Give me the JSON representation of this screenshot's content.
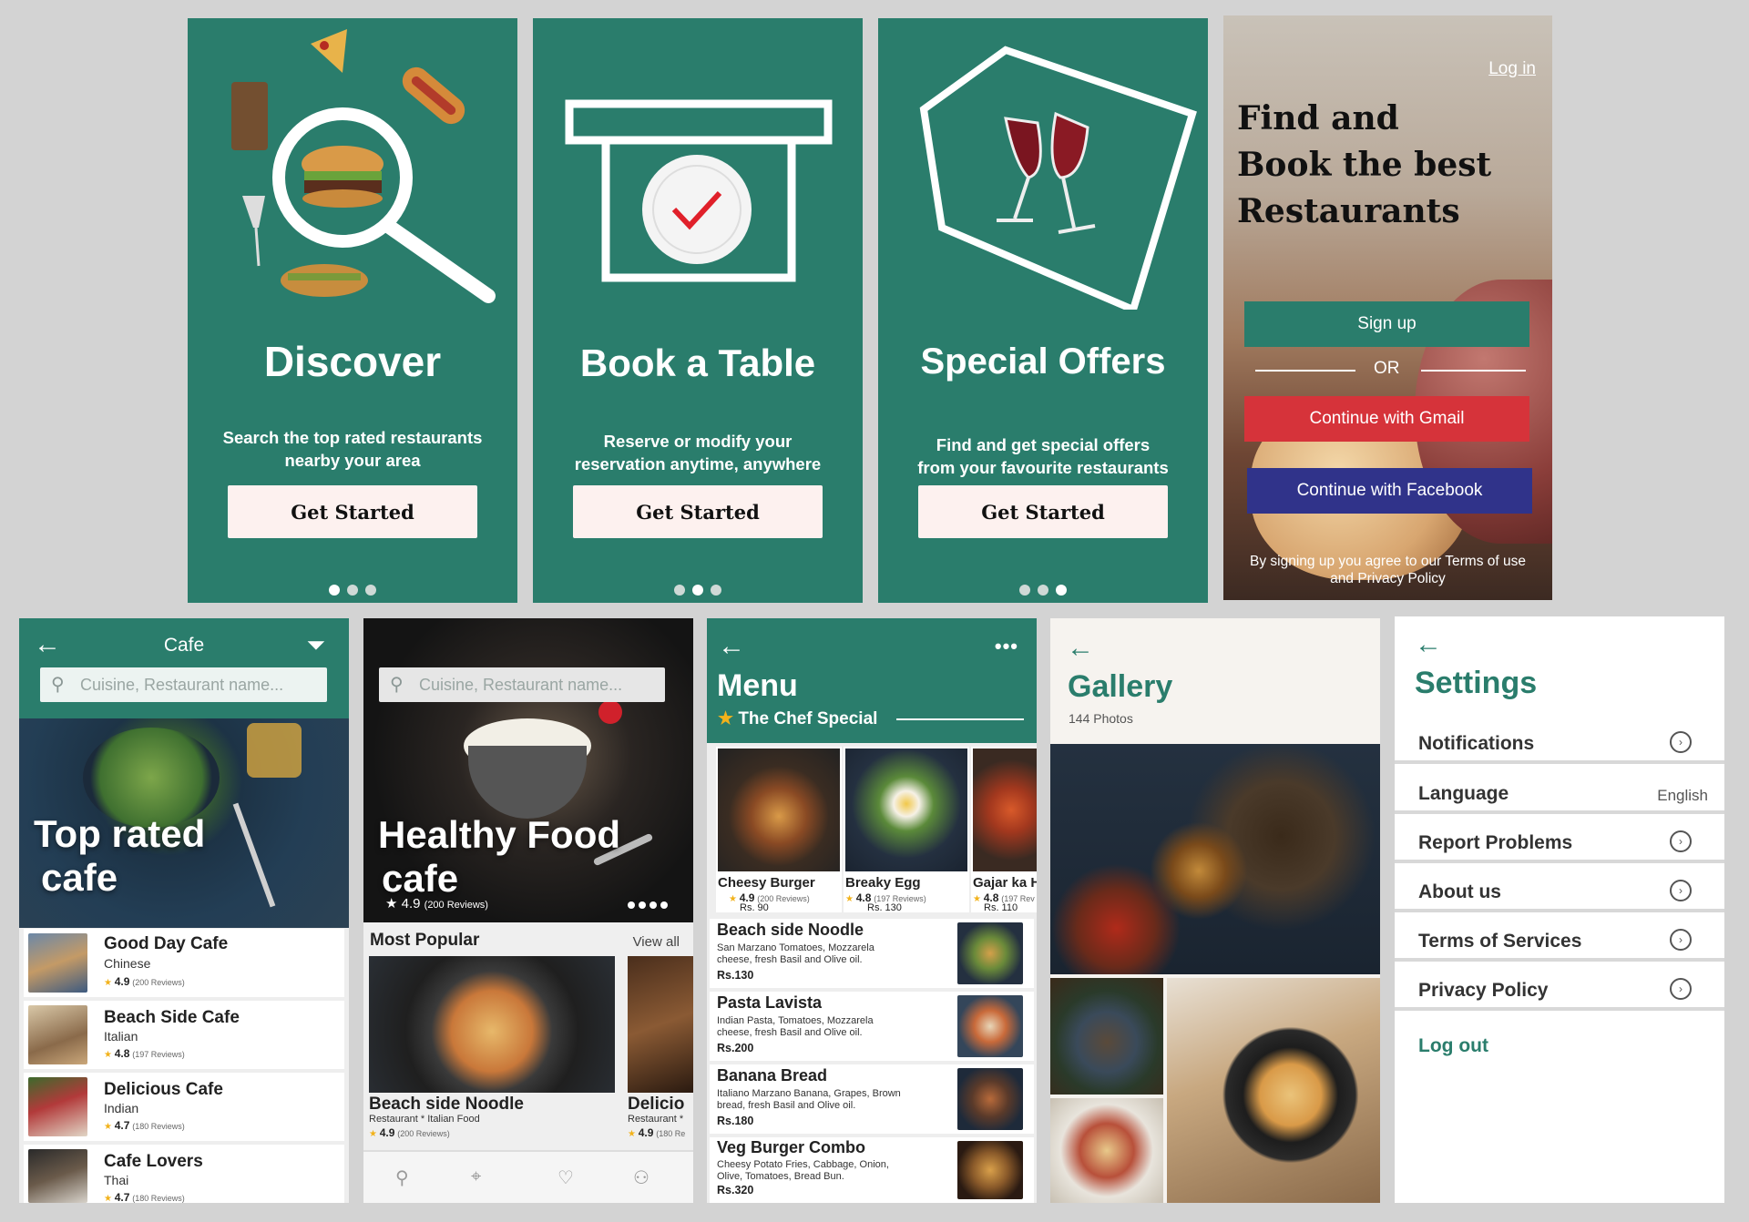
{
  "onboarding": [
    {
      "title": "Discover",
      "desc_line1": "Search the top rated restaurants",
      "desc_line2": "nearby your area",
      "button": "Get Started",
      "active_dot": 0
    },
    {
      "title": "Book a Table",
      "desc_line1": "Reserve or modify your",
      "desc_line2": "reservation anytime, anywhere",
      "button": "Get Started",
      "active_dot": 1
    },
    {
      "title": "Special Offers",
      "desc_line1": "Find and get special offers",
      "desc_line2": "from your favourite restaurants",
      "button": "Get Started",
      "active_dot": 2
    }
  ],
  "login": {
    "login_link": "Log in",
    "headline_1": "Find and",
    "headline_2": "Book the best",
    "headline_3": "Restaurants",
    "signup": "Sign up",
    "or": "OR",
    "gmail": "Continue with Gmail",
    "facebook": "Continue with Facebook",
    "terms_1": "By signing up you agree to our Terms of use",
    "terms_2": "and Privacy Policy",
    "colors": {
      "signup": "#2a7d6c",
      "gmail": "#d6333a",
      "facebook": "#30338a"
    }
  },
  "cafe": {
    "title": "Cafe",
    "search_placeholder": "Cuisine, Restaurant name...",
    "hero_line1": "Top rated",
    "hero_line2": "cafe",
    "items": [
      {
        "name": "Good Day Cafe",
        "cuisine": "Chinese",
        "rating": "4.9",
        "reviews": "(200 Reviews)"
      },
      {
        "name": "Beach Side Cafe",
        "cuisine": "Italian",
        "rating": "4.8",
        "reviews": "(197 Reviews)"
      },
      {
        "name": "Delicious Cafe",
        "cuisine": "Indian",
        "rating": "4.7",
        "reviews": "(180 Reviews)"
      },
      {
        "name": "Cafe Lovers",
        "cuisine": "Thai",
        "rating": "4.7",
        "reviews": "(180 Reviews)"
      }
    ]
  },
  "healthy": {
    "search_placeholder": "Cuisine, Restaurant name...",
    "hero_line1": "Healthy Food",
    "hero_line2": "cafe",
    "hero_rating": "4.9",
    "hero_reviews": "(200 Reviews)",
    "section_title": "Most Popular",
    "view_all": "View all",
    "cards": [
      {
        "name": "Beach side Noodle",
        "meta": "Restaurant * Italian Food",
        "rating": "4.9",
        "reviews": "(200 Reviews)"
      },
      {
        "name": "Delicio",
        "meta": "Restaurant *",
        "rating": "4.9",
        "reviews": "(180 Re"
      }
    ]
  },
  "menu": {
    "title": "Menu",
    "chef_special": "The Chef Special",
    "specials": [
      {
        "name": "Cheesy Burger",
        "rating": "4.9",
        "reviews": "(200 Reviews)",
        "price": "Rs. 90"
      },
      {
        "name": "Breaky Egg",
        "rating": "4.8",
        "reviews": "(197 Reviews)",
        "price": "Rs. 130"
      },
      {
        "name": "Gajar ka H",
        "rating": "4.8",
        "reviews": "(197 Rev",
        "price": "Rs. 110"
      }
    ],
    "items": [
      {
        "name": "Beach side Noodle",
        "desc_1": "San Marzano Tomatoes, Mozzarela",
        "desc_2": "cheese, fresh Basil and Olive oil.",
        "price": "Rs.130"
      },
      {
        "name": "Pasta Lavista",
        "desc_1": "Indian Pasta, Tomatoes, Mozzarela",
        "desc_2": "cheese, fresh Basil and Olive oil.",
        "price": "Rs.200"
      },
      {
        "name": "Banana Bread",
        "desc_1": "Italiano Marzano Banana, Grapes, Brown",
        "desc_2": "bread, fresh Basil and Olive oil.",
        "price": "Rs.180"
      },
      {
        "name": "Veg Burger Combo",
        "desc_1": "Cheesy Potato Fries, Cabbage, Onion,",
        "desc_2": "Olive, Tomatoes, Bread Bun.",
        "price": "Rs.320"
      }
    ]
  },
  "gallery": {
    "title": "Gallery",
    "count": "144 Photos"
  },
  "settings": {
    "title": "Settings",
    "rows": [
      {
        "label": "Notifications"
      },
      {
        "label": "Language",
        "value": "English"
      },
      {
        "label": "Report Problems"
      },
      {
        "label": "About us"
      },
      {
        "label": "Terms of Services"
      },
      {
        "label": "Privacy Policy"
      }
    ],
    "logout": "Log out"
  }
}
